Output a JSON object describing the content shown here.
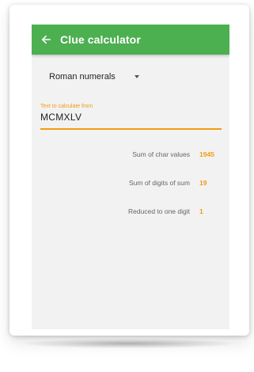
{
  "appbar": {
    "title": "Clue calculator",
    "color": "#4caf50",
    "back_icon": "arrow-left-icon"
  },
  "selector": {
    "selected": "Roman numerals",
    "icon": "caret-down-icon"
  },
  "input": {
    "label": "Text to calculate from",
    "value": "MCMXLV",
    "accent_color": "#f39c12"
  },
  "results": [
    {
      "label": "Sum of char values",
      "value": "1945"
    },
    {
      "label": "Sum of digits of sum",
      "value": "19"
    },
    {
      "label": "Reduced to one digit",
      "value": "1"
    }
  ]
}
